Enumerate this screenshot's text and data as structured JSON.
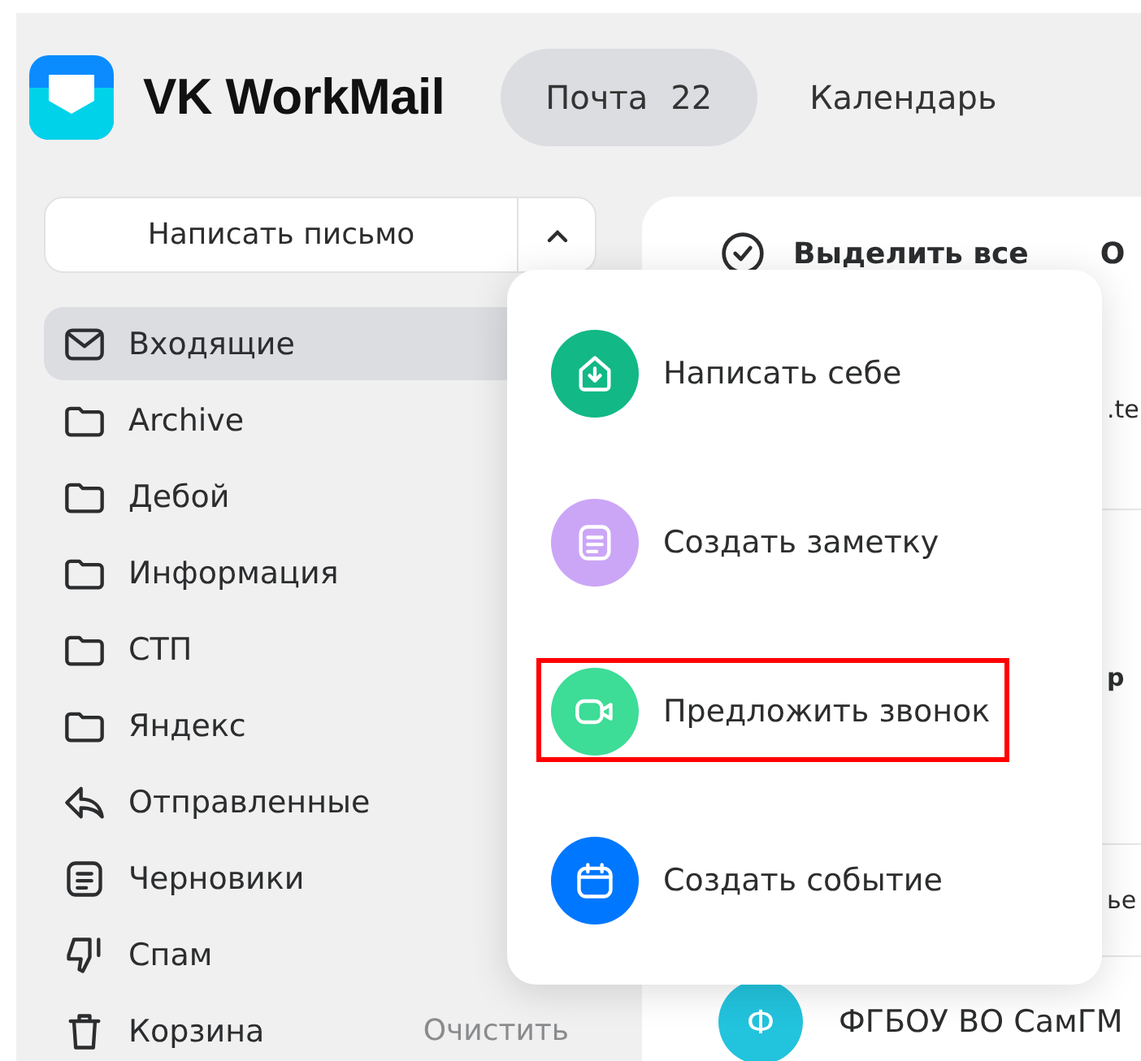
{
  "app": {
    "title": "VK WorkMail"
  },
  "nav_tabs": [
    {
      "label": "Почта",
      "badge": "22",
      "selected": true
    },
    {
      "label": "Календарь",
      "selected": false
    }
  ],
  "compose": {
    "label": "Написать письмо",
    "expanded": true
  },
  "folders": [
    {
      "label": "Входящие",
      "kind": "inbox",
      "selected": true
    },
    {
      "label": "Archive",
      "kind": "folder",
      "selected": false
    },
    {
      "label": "Дебой",
      "kind": "folder",
      "selected": false
    },
    {
      "label": "Информация",
      "kind": "folder",
      "selected": false
    },
    {
      "label": "СТП",
      "kind": "folder",
      "selected": false
    },
    {
      "label": "Яндекс",
      "kind": "folder",
      "selected": false
    },
    {
      "label": "Отправленные",
      "kind": "sent",
      "selected": false
    },
    {
      "label": "Черновики",
      "kind": "drafts",
      "selected": false
    },
    {
      "label": "Спам",
      "kind": "spam",
      "selected": false
    },
    {
      "label": "Корзина",
      "kind": "trash",
      "selected": false,
      "action": "Очистить"
    }
  ],
  "toolbar": {
    "select_all": "Выделить все",
    "next_item": "О"
  },
  "message_rows": [
    {
      "text": ".te",
      "bold": false
    },
    {
      "text": "р",
      "bold": true
    },
    {
      "text": "ье",
      "bold": false
    }
  ],
  "last_message": {
    "avatar": "Ф",
    "sender": "ФГБОУ ВО СамГМ"
  },
  "compose_menu": [
    {
      "label": "Написать себе",
      "kind": "home",
      "color": "#12b886",
      "highlighted": false
    },
    {
      "label": "Создать заметку",
      "kind": "note",
      "color": "#cba6f7",
      "highlighted": false
    },
    {
      "label": "Предложить звонок",
      "kind": "video",
      "color": "#3ddc97",
      "highlighted": true
    },
    {
      "label": "Создать событие",
      "kind": "calendar",
      "color": "#0077ff",
      "highlighted": false
    }
  ]
}
